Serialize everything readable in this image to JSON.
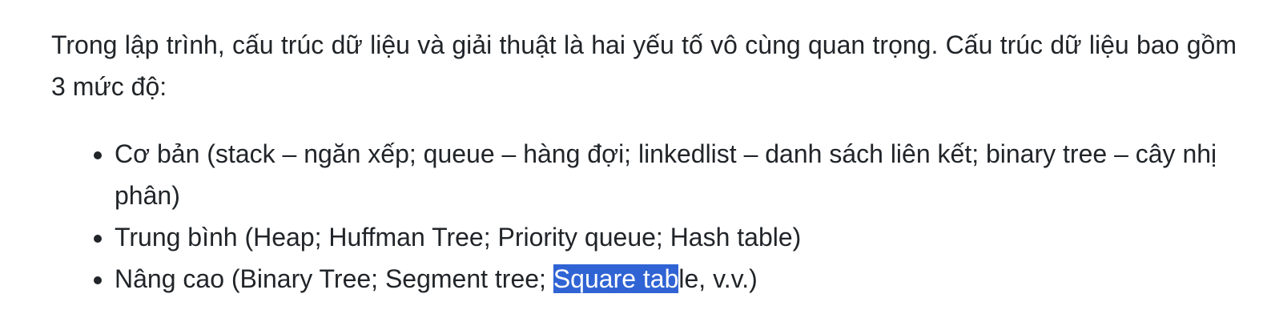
{
  "article": {
    "intro": "Trong lập trình, cấu trúc dữ liệu và giải thuật là hai yếu tố vô cùng quan trọng. Cấu trúc dữ liệu bao gồm 3 mức độ:",
    "levels": [
      {
        "text": "Cơ bản (stack – ngăn xếp; queue – hàng đợi; linkedlist – danh sách liên kết; binary tree – cây nhị phân)"
      },
      {
        "text": "Trung bình (Heap; Huffman Tree; Priority queue; Hash table)"
      },
      {
        "text_before": "Nâng cao (Binary Tree; Segment tree; ",
        "selected_text": "Square tab",
        "text_after": "le, v.v.)"
      }
    ]
  },
  "colors": {
    "text": "#212529",
    "selection_background": "#3064d4",
    "selection_text": "#ffffff"
  }
}
